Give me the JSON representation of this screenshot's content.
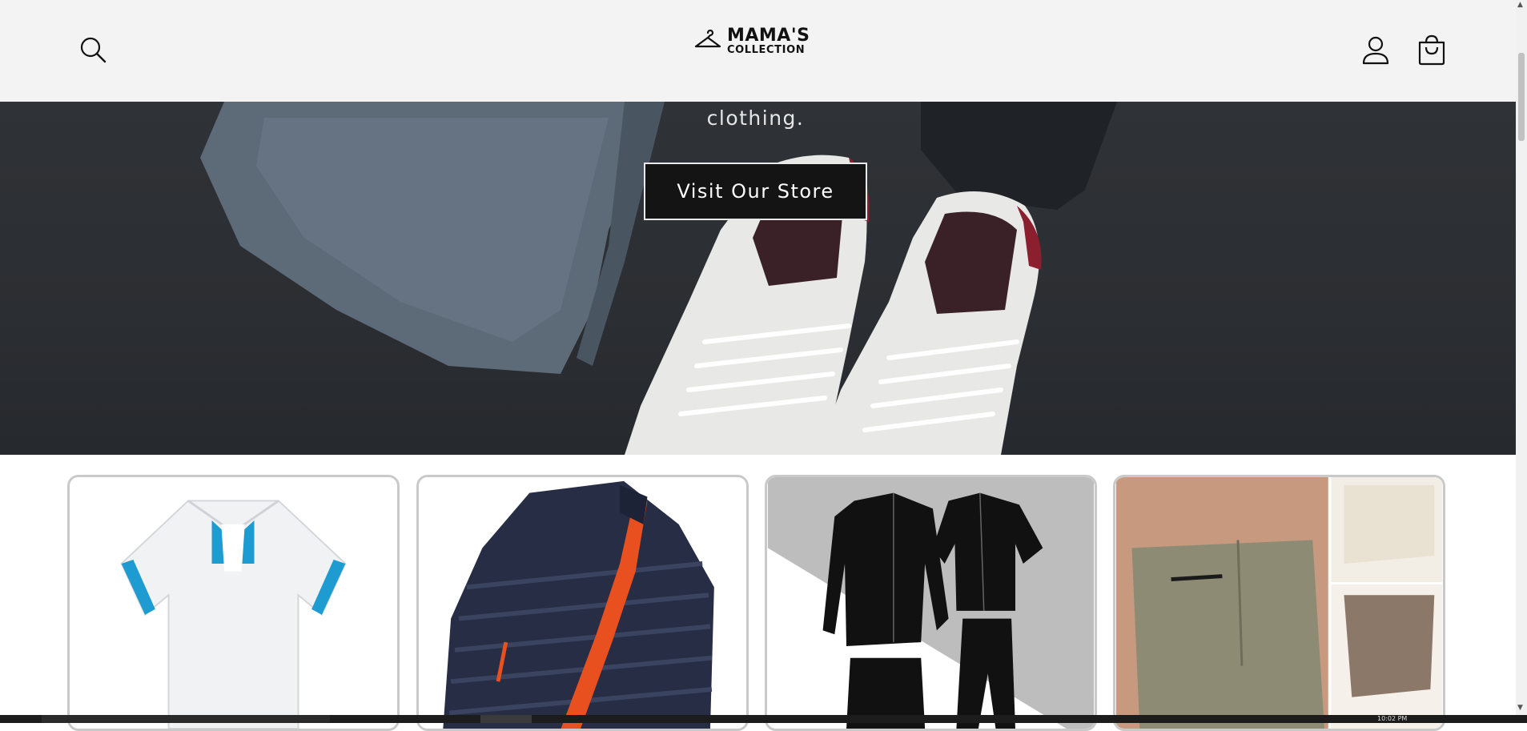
{
  "header": {
    "brand_line1": "MAMA'S",
    "brand_line2": "COLLECTION",
    "icons": [
      "search-icon",
      "hanger-icon",
      "account-icon",
      "cart-icon"
    ]
  },
  "hero": {
    "subtitle": "clothing.",
    "cta_label": "Visit Our Store"
  },
  "collections": [
    {
      "subject": "white polo shirt with blue trim"
    },
    {
      "subject": "navy puffer jacket with orange lining"
    },
    {
      "subject": "black compression sportswear set"
    },
    {
      "subject": "men's cargo shorts"
    }
  ],
  "taskbar": {
    "clock": "10:02 PM"
  },
  "colors": {
    "header_bg": "#f3f3f3",
    "hero_bg": "#2b2e32",
    "button_bg": "#141414",
    "card_border": "#c9c9c9"
  }
}
